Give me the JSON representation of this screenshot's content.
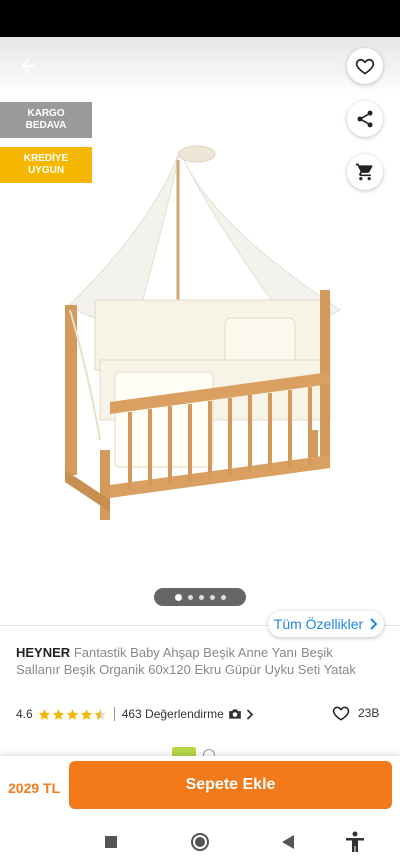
{
  "badges": {
    "cargo": [
      "KARGO",
      "BEDAVA"
    ],
    "credit": [
      "KREDİYE",
      "UYGUN"
    ]
  },
  "icons": {
    "back": "arrow-left-icon",
    "favorite": "heart-outline-icon",
    "share": "share-icon",
    "cart": "cart-icon"
  },
  "gallery": {
    "total_images": 5,
    "active_index": 0
  },
  "features_link": "Tüm Özellikler",
  "product": {
    "brand": "HEYNER",
    "name": "Fantastik Baby Ahşap Beşik Anne Yanı Beşik Sallanır Beşik Organik 60x120 Ekru Güpür Uyku Seti Yatak"
  },
  "rating": {
    "score": "4.6",
    "stars": 4.6,
    "reviews": "463 Değerlendirme"
  },
  "likes": "23B",
  "price": "2029 TL",
  "add_to_cart": "Sepete Ekle",
  "colors": {
    "accent": "#f27a1a",
    "link": "#1e88e5",
    "star": "#f5b700",
    "badge_cargo": "#9a9a9a",
    "badge_credit": "#f5b700"
  }
}
